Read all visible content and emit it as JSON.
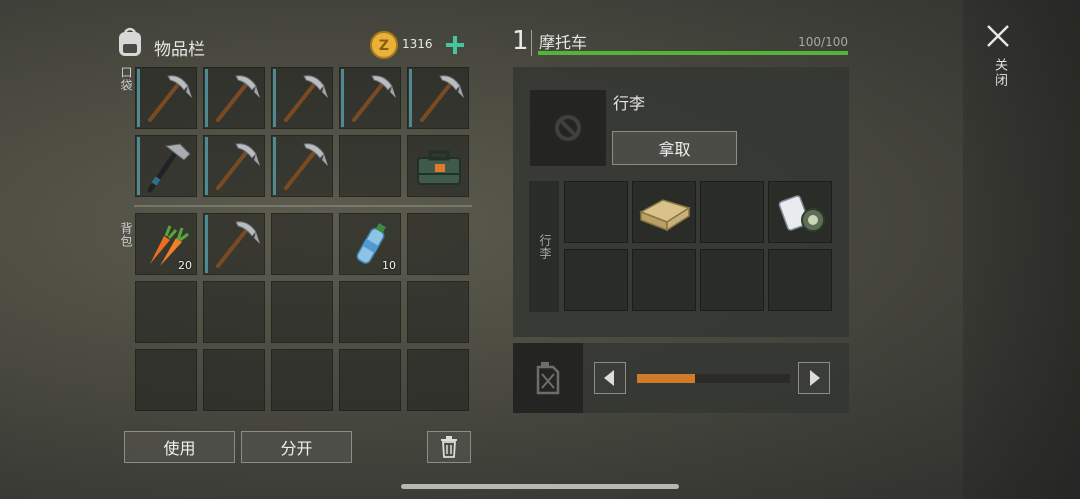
{
  "inventory": {
    "title": "物品栏",
    "coins": "1316",
    "pocket_label": "口袋",
    "backpack_label": "背包",
    "pocket_slots": [
      "pickaxe",
      "pickaxe",
      "pickaxe",
      "pickaxe",
      "pickaxe",
      "hatchet",
      "pickaxe",
      "pickaxe",
      "empty",
      "toolbox"
    ],
    "backpack_items": [
      {
        "item": "carrot",
        "qty": "20"
      },
      {
        "item": "pickaxe",
        "qty": ""
      },
      {
        "item": "empty",
        "qty": ""
      },
      {
        "item": "water-bottle",
        "qty": "10"
      },
      {
        "item": "empty",
        "qty": ""
      }
    ]
  },
  "actions": {
    "use_label": "使用",
    "split_label": "分开"
  },
  "vehicle": {
    "number": "1",
    "name": "摩托车",
    "health": "100/100",
    "health_fraction": 1.0,
    "storage_title": "行李",
    "take_label": "拿取",
    "cargo_label": "行李",
    "cargo_items": [
      "empty",
      "crate",
      "empty",
      "map-roll",
      "empty",
      "empty",
      "empty",
      "empty"
    ],
    "fuel_fraction": 0.38
  },
  "close_label": "关闭",
  "colors": {
    "health": "#54b43a",
    "fuel": "#d07a2b",
    "coin": "#e8b23a",
    "plus": "#46c4a0",
    "durability": "#4f8a92"
  }
}
